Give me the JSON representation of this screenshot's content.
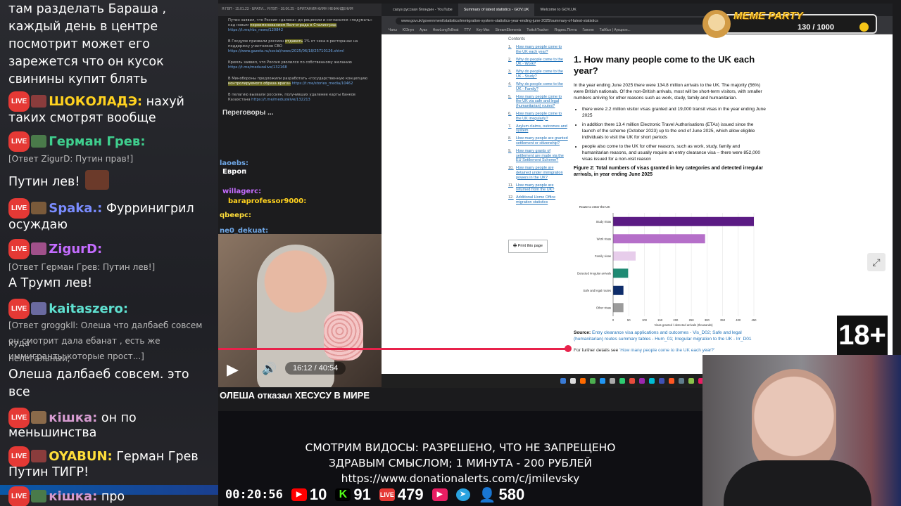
{
  "chat": {
    "messages": [
      {
        "kind": "text",
        "text": "там разделать Бараша ,"
      },
      {
        "kind": "text",
        "text": "каждый день в центре"
      },
      {
        "kind": "text",
        "text": "посмотрит может его"
      },
      {
        "kind": "text",
        "text": "зарежется что он кусок"
      },
      {
        "kind": "text",
        "text": "свинины купит блять"
      },
      {
        "kind": "msg",
        "nick": "ШОКОЛАДЭ:",
        "nick_color": "#ffd21f",
        "text": "нахуй"
      },
      {
        "kind": "text",
        "text": "таких смотрят вообще"
      },
      {
        "kind": "msg",
        "nick": "Герман Грев:",
        "nick_color": "#3fcf8e",
        "text": ""
      },
      {
        "kind": "reply",
        "text": "[Ответ ZigurD: Путин прав!]"
      },
      {
        "kind": "text",
        "text": "Путин лев!"
      },
      {
        "kind": "msg",
        "nick": "Spaka.:",
        "nick_color": "#7a8cff",
        "text": "Фурринигрил"
      },
      {
        "kind": "text",
        "text": "осуждаю"
      },
      {
        "kind": "msg",
        "nick": "ZigurD:",
        "nick_color": "#c46cff",
        "text": ""
      },
      {
        "kind": "reply",
        "text": "[Ответ Герман Грев: Путин лев!]"
      },
      {
        "kind": "text",
        "text": "А Трумп лев!"
      },
      {
        "kind": "msg",
        "nick": "kaitaszero:",
        "nick_color": "#5fe0d0",
        "text": ""
      },
      {
        "kind": "reply",
        "text": "[Ответ groggkll: Олеша что далбаеб совсем куда"
      },
      {
        "kind": "reply",
        "text": "он смотрит дала ебанат , есть же нелегальный,"
      },
      {
        "kind": "reply",
        "text": "иммигранты которые прост...]"
      },
      {
        "kind": "text",
        "text": "Олеша далбаеб совсем. это"
      },
      {
        "kind": "text",
        "text": "все"
      },
      {
        "kind": "msg",
        "nick": "кішка:",
        "nick_color": "#d69bd0",
        "text": "он по"
      },
      {
        "kind": "text",
        "text": "меньшинства"
      },
      {
        "kind": "msg",
        "nick": "OYABUN:",
        "nick_color": "#ffde3a",
        "text": "Герман Грев"
      },
      {
        "kind": "text",
        "text": "Путин ТИГР!"
      },
      {
        "kind": "msg",
        "nick": "кішка:",
        "nick_color": "#d69bd0",
        "text": "про"
      }
    ],
    "live_label": "LIVE"
  },
  "telegram": {
    "tabs": "Я ГВП - 15.01.23 - БРАТИ...   Я ГВП - 18.06.25 - БРИТАНИЯ-КИЯН НЕФАНДЕНИЯ",
    "items": [
      {
        "text": "Путин заявил, что Россия «далека» до рецессии и согласился «подумать» над новым ",
        "hl": "переименованием Волгограда в Сталинград",
        "link": " https://t.me/rbc_news/120842"
      },
      {
        "text": "В Госдуме призвали россиян ",
        "hl": "отдавать",
        "text2": " 1% от чека в ресторанах на поддержку участников СВО ",
        "link": "https://www.gazeta.ru/social/news/2025/06/18/25710126.shtml"
      },
      {
        "text": "Кремль заявил, что Россия уволился по собственному желанию ",
        "hl": "",
        "link": "https://t.me/meduzalive/132168"
      },
      {
        "text": "В Минобороны предложили разработать «государственную концепцию ",
        "hl": "контролируемого образа врага»",
        "link": " https://t.me/stories_media/10462"
      },
      {
        "text": "В пелагию вызвали россиян, получивших удаление карты банков Казахстана ",
        "hl": "",
        "link": "https://t.me/meduzalive/132213"
      }
    ],
    "section": "Переговоры ...",
    "overlay_nicks": [
      {
        "nick": "laoebs:",
        "color": "#6fa7e6"
      },
      {
        "nick": "Европ",
        "color": "#ffffff"
      },
      {
        "nick": "willagerc:",
        "color": "#c46cff"
      },
      {
        "nick": "baraprofessor9000:",
        "color": "#ffd21f"
      },
      {
        "nick": "qbeepc:",
        "color": "#ffde3a"
      },
      {
        "nick": "ne0_dekuat:",
        "color": "#6fa7e6"
      }
    ]
  },
  "video": {
    "time": "16:12 / 40:54",
    "progress_fraction": 0.396
  },
  "browser": {
    "tabs": [
      "сахуз русская блондин - YouTube",
      "Summary of latest statistics - GOV.UK",
      "Welcome to GOV.UK"
    ],
    "url": "www.gov.uk/government/statistics/immigration-system-statistics-year-ending-june-2025/summary-of-latest-statistics",
    "bookmarks": [
      "Чаты",
      "ЮЗнуп",
      "Ауак",
      "HowLongToBeat",
      "TTV",
      "Кеу-Мкх",
      "StreamElements",
      "TwitchTracker",
      "Яндекс.Почта",
      "Гапоян",
      "Тайбьо | Аукцион..."
    ],
    "contents_heading": "Contents",
    "contents": [
      {
        "n": "1.",
        "t": "How many people come to the UK each year?"
      },
      {
        "n": "2.",
        "t": "Why do people come to the UK - Work?"
      },
      {
        "n": "3.",
        "t": "Why do people come to the UK - Study?"
      },
      {
        "n": "4.",
        "t": "Why do people come to the UK - Family?"
      },
      {
        "n": "5.",
        "t": "How many people come to the UK via safe and legal (humanitarian) routes?"
      },
      {
        "n": "6.",
        "t": "How many people come to the UK irregularly?"
      },
      {
        "n": "7.",
        "t": "Asylum claims, outcomes and system"
      },
      {
        "n": "8.",
        "t": "How many people are granted settlement or citizenship?"
      },
      {
        "n": "9.",
        "t": "How many grants of settlement are made via the EU Settlement Scheme?"
      },
      {
        "n": "10.",
        "t": "How many people are detained under immigration powers in the UK?"
      },
      {
        "n": "11.",
        "t": "How many people are returned from the UK?"
      },
      {
        "n": "12.",
        "t": "Additional Home Office migration statistics"
      }
    ],
    "print_label": "Print this page",
    "heading": "1. How many people come to the UK each year?",
    "para1": "In the year ending June 2025 there were 134.8 million arrivals to the UK. The majority (56%) were British nationals. Of the non-British arrivals, most will be short-term visitors, with smaller numbers arriving for other reasons such as work, study, family and humanitarian.",
    "bullets": [
      "there were 2.2 million visitor visas granted and 19,000 transit visas in the year ending June 2025",
      "in addition there 13.4 million Electronic Travel Authorisations (ETAs) issued since the launch of the scheme (October 2023) up to the end of June 2025, which allow eligible individuals to visit the UK for short periods",
      "people also come to the UK for other reasons, such as work, study, family and humanitarian reasons, and usually require an entry clearance visa – there were 852,000 visas issued for a non-visit reason"
    ],
    "figure_title": "Figure 2: Total numbers of visas granted in key categories and detected irregular arrivals, in year ending June 2025",
    "source_label": "Source:",
    "source_link": "Entry clearance visa applications and outcomes - Vis_D02; Safe and legal (humanitarian) routes summary tables - Hum_01; Irregular migration to the UK - Irr_D01",
    "further_prefix": "For further details see",
    "further_link": "'How many people come to the UK each year?'"
  },
  "chart_data": {
    "type": "bar",
    "orientation": "horizontal",
    "title": "Figure 2: Total numbers of visas granted in key categories and detected irregular arrivals, in year ending June 2025",
    "ylabel": "Route to enter the UK",
    "xlabel": "Visas granted / detected arrivals (thousands)",
    "categories": [
      "Study visas",
      "Work visas",
      "Family visas",
      "Detected irregular arrivals",
      "Safe and legal routes",
      "Other visas"
    ],
    "values": [
      450,
      294,
      72,
      48,
      33,
      33
    ],
    "colors": [
      "#5b1b84",
      "#b56fc9",
      "#e7cdeb",
      "#1f8a73",
      "#0e2c6a",
      "#9b9b9b"
    ],
    "xlim": [
      0,
      450
    ],
    "xticks": [
      0,
      50,
      100,
      150,
      200,
      250,
      300,
      350,
      400,
      450
    ],
    "grid": true
  },
  "title_bar": "ОЛЕША отказал ХЕСУСУ В МИРЕ",
  "meme_party": {
    "title": "MEME PARTY",
    "count": "130 / 1000"
  },
  "rating": "18+",
  "donate": {
    "line1": "СМОТРИМ ВИДОСЫ: РАЗРЕШЕНО, ЧТО НЕ ЗАПРЕЩЕНО",
    "line2": "ЗДРАВЫМ СМЫСЛОМ; 1 МИНУТА - 200 РУБЛЕЙ",
    "line3": "https://www.donationalerts.com/c/jmilevsky"
  },
  "stats": {
    "timer": "00:20:56",
    "youtube": "10",
    "kick": "91",
    "vk_live": "479",
    "rutube": "",
    "telegram": "",
    "viewers": "580",
    "colors": {
      "youtube": "#ff0000",
      "kick": "#53fc18",
      "vk": "#e53935",
      "telegram": "#2aa3e0",
      "viewers": "#3ba1ff"
    }
  }
}
